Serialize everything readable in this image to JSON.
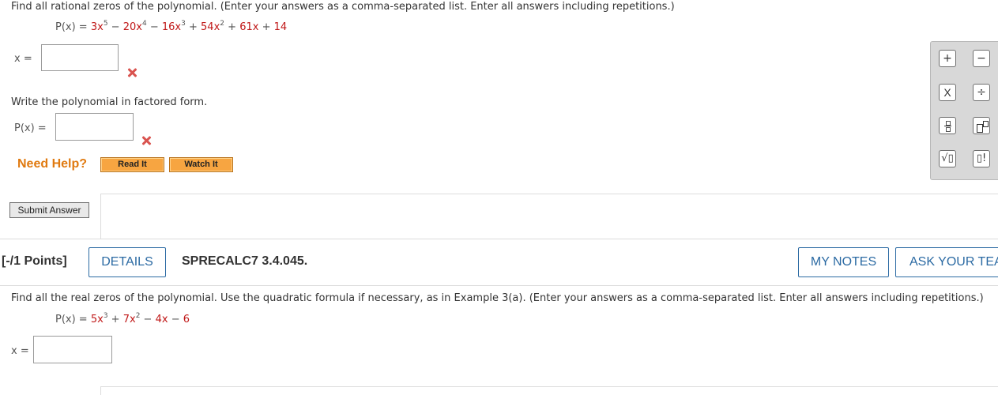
{
  "q1": {
    "prompt": "Find all rational zeros of the polynomial. (Enter your answers as a comma-separated list. Enter all answers including repetitions.)",
    "poly_lhs": "P(x) = ",
    "poly_t1": "3x",
    "poly_e1": "5",
    "poly_op1": " − ",
    "poly_t2": "20x",
    "poly_e2": "4",
    "poly_op2": " − ",
    "poly_t3": "16x",
    "poly_e3": "3",
    "poly_op3": " + ",
    "poly_t4": "54x",
    "poly_e4": "2",
    "poly_op4": " + ",
    "poly_t5": "61x",
    "poly_op5": " + ",
    "poly_t6": "14",
    "x_label": "x =",
    "x_value": "",
    "factored_prompt": "Write the polynomial in factored form.",
    "p_label": "P(x) =",
    "p_value": ""
  },
  "help": {
    "label": "Need Help?",
    "read_it": "Read It",
    "watch_it": "Watch It"
  },
  "submit_label": "Submit Answer",
  "palette": {
    "plus": "+",
    "minus": "−",
    "times": "X",
    "divide": "÷",
    "fraction": "▯/▯",
    "power": "▯▯",
    "sqrt": "√▯",
    "factorial": "▯!"
  },
  "q2": {
    "points": "[-/1 Points]",
    "details": "DETAILS",
    "code": "SPRECALC7 3.4.045.",
    "my_notes": "MY NOTES",
    "ask_teacher": "ASK YOUR TEA",
    "prompt": "Find all the real zeros of the polynomial. Use the quadratic formula if necessary, as in Example 3(a). (Enter your answers as a comma-separated list. Enter all answers including repetitions.)",
    "poly_lhs": "P(x) = ",
    "poly_t1": "5x",
    "poly_e1": "3",
    "poly_op1": " + ",
    "poly_t2": "7x",
    "poly_e2": "2",
    "poly_op2": " − ",
    "poly_t3": "4x",
    "poly_op3": " − ",
    "poly_t4": "6",
    "x_label": "x =",
    "x_value": ""
  },
  "colors": {
    "coef_red": "#c01818",
    "help_orange": "#e07a10",
    "link_blue": "#2b6aa3",
    "incorrect_red": "#d9534f"
  }
}
